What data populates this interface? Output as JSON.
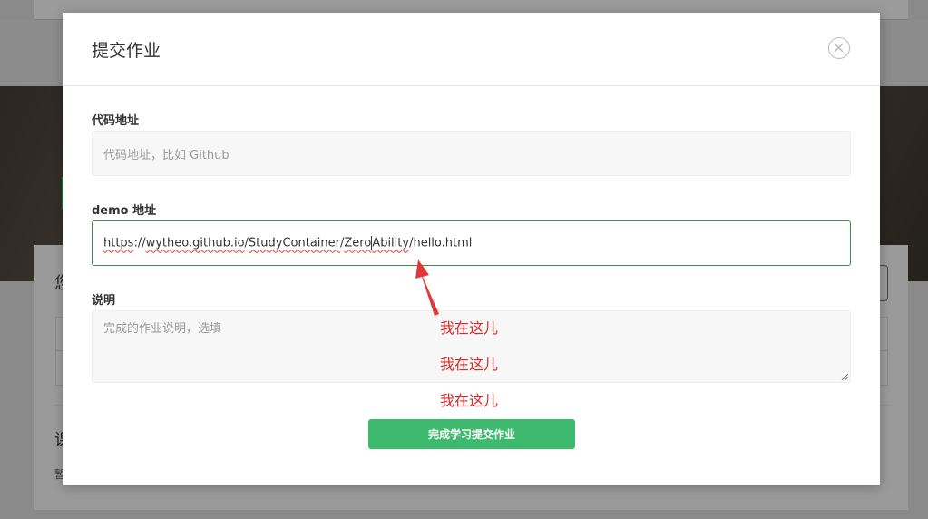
{
  "background": {
    "heading_1": "您",
    "heading_2": "课",
    "small_text": "暂"
  },
  "modal": {
    "title": "提交作业",
    "close_icon": "close-circle-icon",
    "code_field": {
      "label": "代码地址",
      "placeholder": "代码地址，比如 Github",
      "value": ""
    },
    "demo_field": {
      "label": "demo 地址",
      "value": "https://wytheo.github.io/StudyContainer/ZeroAbility/hello.html",
      "value_parts": {
        "p1": "https",
        "p2": "://",
        "p3": "wytheo.github.io",
        "p4": "/",
        "p5": "StudyContainer",
        "p6": "/",
        "p7": "Zero",
        "p8": "Ability",
        "p9": "/hello.html"
      }
    },
    "description_field": {
      "label": "说明",
      "placeholder": "完成的作业说明，选填"
    },
    "submit_label": "完成学习提交作业"
  },
  "annotation": {
    "color": "#d92b2b",
    "lines": [
      "我在这儿",
      "我在这儿",
      "我在这儿"
    ]
  },
  "colors": {
    "accent_green": "#3dba6e",
    "focus_border": "#3d8a4f"
  }
}
